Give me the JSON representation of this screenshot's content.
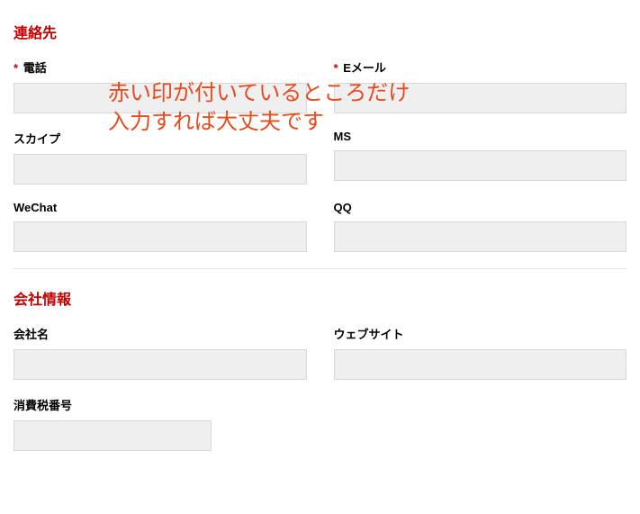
{
  "overlay": {
    "text": "赤い印が付いているところだけ\n入力すれば大丈夫です"
  },
  "section_contact": {
    "heading": "連絡先",
    "required_marker": "*",
    "phone_label": "電話",
    "email_label": "Eメール",
    "ms_label": "MS",
    "skype_label": "スカイプ",
    "wechat_label": "WeChat",
    "qq_label": "QQ"
  },
  "section_company": {
    "heading": "会社情報",
    "company_name_label": "会社名",
    "website_label": "ウェブサイト",
    "tax_number_label": "消費税番号"
  }
}
